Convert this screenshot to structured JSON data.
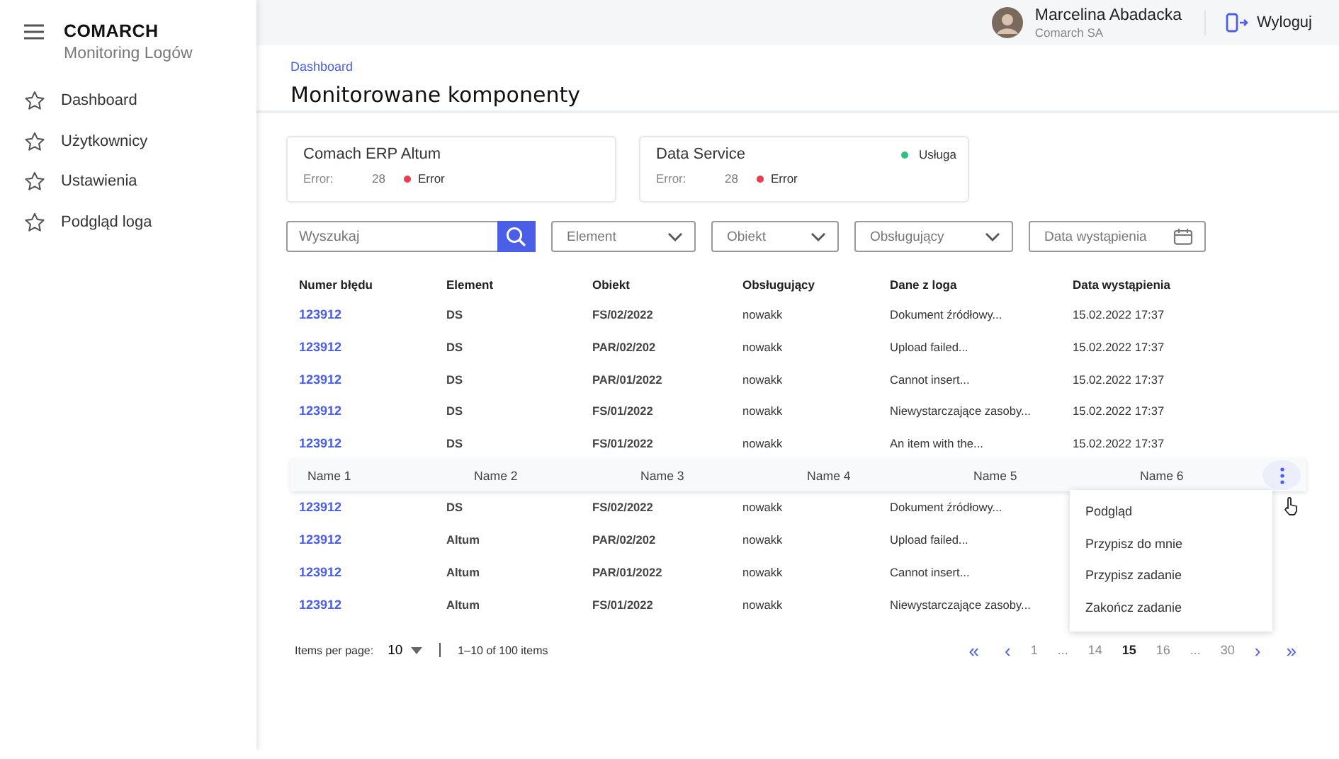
{
  "sidebar": {
    "brand": "COMARCH",
    "subtitle": "Monitoring Logów",
    "items": [
      {
        "label": "Dashboard",
        "selected": false
      },
      {
        "label": "Użytkownicy",
        "selected": false
      },
      {
        "label": "Ustawienia",
        "selected": false
      },
      {
        "label": "Podgląd loga",
        "selected": false
      }
    ]
  },
  "topbar": {
    "user_name": "Marcelina Abadacka",
    "company": "Comarch SA",
    "logout": "Wyloguj"
  },
  "breadcrumb": "Dashboard",
  "title": "Monitorowane komponenty",
  "cards": [
    {
      "name": "Comach ERP Altum",
      "error_label": "Error:",
      "error_count": "28",
      "status": {
        "label": "Error",
        "color": "#f0394a"
      }
    },
    {
      "name": "Data Service",
      "error_label": "Error:",
      "error_count": "28",
      "status": {
        "label": "Error",
        "color": "#f0394a"
      },
      "badge": {
        "label": "Usługa",
        "color": "#2ec27e"
      }
    }
  ],
  "filters": {
    "search_placeholder": "Wyszukaj",
    "selects": [
      {
        "kind": "dropdown",
        "placeholder": "Element"
      },
      {
        "kind": "dropdown",
        "placeholder": "Obiekt"
      },
      {
        "kind": "dropdown",
        "placeholder": "Obsługujący"
      },
      {
        "kind": "date",
        "placeholder": "Data wystąpienia"
      }
    ]
  },
  "table": {
    "columns": [
      "Numer błędu",
      "Element",
      "Obiekt",
      "Obsługujący",
      "Dane z loga",
      "Data wystąpienia"
    ],
    "rows": [
      {
        "kind": "data",
        "cells": [
          "123912",
          "DS",
          "FS/02/2022",
          "nowakk",
          "Dokument źródłowy...",
          "15.02.2022 17:37"
        ]
      },
      {
        "kind": "data",
        "cells": [
          "123912",
          "DS",
          "PAR/02/202",
          "nowakk",
          "Upload failed...",
          "15.02.2022 17:37"
        ]
      },
      {
        "kind": "data",
        "cells": [
          "123912",
          "DS",
          "PAR/01/2022",
          "nowakk",
          "Cannot insert...",
          "15.02.2022 17:37"
        ]
      },
      {
        "kind": "data",
        "cells": [
          "123912",
          "DS",
          "FS/01/2022",
          "nowakk",
          "Niewystarczające zasoby...",
          "15.02.2022 17:37"
        ]
      },
      {
        "kind": "data",
        "cells": [
          "123912",
          "DS",
          "FS/01/2022",
          "nowakk",
          "An item with the...",
          "15.02.2022 17:37"
        ]
      },
      {
        "kind": "hover",
        "cells": [
          "Name 1",
          "Name 2",
          "Name 3",
          "Name 4",
          "Name 5",
          "Name 6"
        ]
      },
      {
        "kind": "data",
        "cells": [
          "123912",
          "DS",
          "FS/02/2022",
          "nowakk",
          "Dokument źródłowy..."
        ]
      },
      {
        "kind": "data",
        "cells": [
          "123912",
          "Altum",
          "PAR/02/202",
          "nowakk",
          "Upload failed..."
        ]
      },
      {
        "kind": "data",
        "cells": [
          "123912",
          "Altum",
          "PAR/01/2022",
          "nowakk",
          "Cannot insert..."
        ]
      },
      {
        "kind": "data",
        "cells": [
          "123912",
          "Altum",
          "FS/01/2022",
          "nowakk",
          "Niewystarczające zasoby..."
        ]
      }
    ]
  },
  "context_menu": [
    "Podgląd",
    "Przypisz do mnie",
    "Przypisz zadanie",
    "Zakończ zadanie"
  ],
  "pagination": {
    "per_page_label": "Items per page:",
    "per_page": "10",
    "range": "1–10 of 100 items",
    "pages": [
      {
        "kind": "first",
        "label": "«",
        "selected": false
      },
      {
        "kind": "prev",
        "label": "‹",
        "selected": false
      },
      {
        "kind": "page",
        "label": "1",
        "selected": false
      },
      {
        "kind": "gap",
        "label": "...",
        "selected": false
      },
      {
        "kind": "page",
        "label": "14",
        "selected": false
      },
      {
        "kind": "page",
        "label": "15",
        "selected": true
      },
      {
        "kind": "page",
        "label": "16",
        "selected": false
      },
      {
        "kind": "gap",
        "label": "...",
        "selected": false
      },
      {
        "kind": "page",
        "label": "30",
        "selected": false
      },
      {
        "kind": "next",
        "label": "›",
        "selected": false
      },
      {
        "kind": "last",
        "label": "»",
        "selected": false
      }
    ]
  }
}
